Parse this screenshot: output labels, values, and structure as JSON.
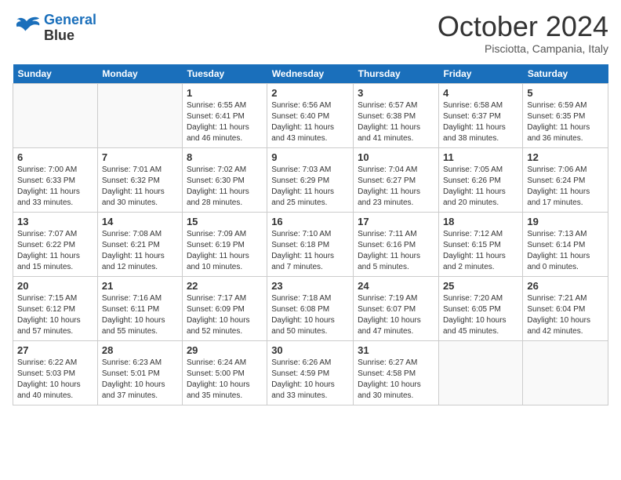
{
  "header": {
    "logo_line1": "General",
    "logo_line2": "Blue",
    "month_title": "October 2024",
    "location": "Pisciotta, Campania, Italy"
  },
  "days_of_week": [
    "Sunday",
    "Monday",
    "Tuesday",
    "Wednesday",
    "Thursday",
    "Friday",
    "Saturday"
  ],
  "weeks": [
    [
      {
        "day": "",
        "info": ""
      },
      {
        "day": "",
        "info": ""
      },
      {
        "day": "1",
        "info": "Sunrise: 6:55 AM\nSunset: 6:41 PM\nDaylight: 11 hours and 46 minutes."
      },
      {
        "day": "2",
        "info": "Sunrise: 6:56 AM\nSunset: 6:40 PM\nDaylight: 11 hours and 43 minutes."
      },
      {
        "day": "3",
        "info": "Sunrise: 6:57 AM\nSunset: 6:38 PM\nDaylight: 11 hours and 41 minutes."
      },
      {
        "day": "4",
        "info": "Sunrise: 6:58 AM\nSunset: 6:37 PM\nDaylight: 11 hours and 38 minutes."
      },
      {
        "day": "5",
        "info": "Sunrise: 6:59 AM\nSunset: 6:35 PM\nDaylight: 11 hours and 36 minutes."
      }
    ],
    [
      {
        "day": "6",
        "info": "Sunrise: 7:00 AM\nSunset: 6:33 PM\nDaylight: 11 hours and 33 minutes."
      },
      {
        "day": "7",
        "info": "Sunrise: 7:01 AM\nSunset: 6:32 PM\nDaylight: 11 hours and 30 minutes."
      },
      {
        "day": "8",
        "info": "Sunrise: 7:02 AM\nSunset: 6:30 PM\nDaylight: 11 hours and 28 minutes."
      },
      {
        "day": "9",
        "info": "Sunrise: 7:03 AM\nSunset: 6:29 PM\nDaylight: 11 hours and 25 minutes."
      },
      {
        "day": "10",
        "info": "Sunrise: 7:04 AM\nSunset: 6:27 PM\nDaylight: 11 hours and 23 minutes."
      },
      {
        "day": "11",
        "info": "Sunrise: 7:05 AM\nSunset: 6:26 PM\nDaylight: 11 hours and 20 minutes."
      },
      {
        "day": "12",
        "info": "Sunrise: 7:06 AM\nSunset: 6:24 PM\nDaylight: 11 hours and 17 minutes."
      }
    ],
    [
      {
        "day": "13",
        "info": "Sunrise: 7:07 AM\nSunset: 6:22 PM\nDaylight: 11 hours and 15 minutes."
      },
      {
        "day": "14",
        "info": "Sunrise: 7:08 AM\nSunset: 6:21 PM\nDaylight: 11 hours and 12 minutes."
      },
      {
        "day": "15",
        "info": "Sunrise: 7:09 AM\nSunset: 6:19 PM\nDaylight: 11 hours and 10 minutes."
      },
      {
        "day": "16",
        "info": "Sunrise: 7:10 AM\nSunset: 6:18 PM\nDaylight: 11 hours and 7 minutes."
      },
      {
        "day": "17",
        "info": "Sunrise: 7:11 AM\nSunset: 6:16 PM\nDaylight: 11 hours and 5 minutes."
      },
      {
        "day": "18",
        "info": "Sunrise: 7:12 AM\nSunset: 6:15 PM\nDaylight: 11 hours and 2 minutes."
      },
      {
        "day": "19",
        "info": "Sunrise: 7:13 AM\nSunset: 6:14 PM\nDaylight: 11 hours and 0 minutes."
      }
    ],
    [
      {
        "day": "20",
        "info": "Sunrise: 7:15 AM\nSunset: 6:12 PM\nDaylight: 10 hours and 57 minutes."
      },
      {
        "day": "21",
        "info": "Sunrise: 7:16 AM\nSunset: 6:11 PM\nDaylight: 10 hours and 55 minutes."
      },
      {
        "day": "22",
        "info": "Sunrise: 7:17 AM\nSunset: 6:09 PM\nDaylight: 10 hours and 52 minutes."
      },
      {
        "day": "23",
        "info": "Sunrise: 7:18 AM\nSunset: 6:08 PM\nDaylight: 10 hours and 50 minutes."
      },
      {
        "day": "24",
        "info": "Sunrise: 7:19 AM\nSunset: 6:07 PM\nDaylight: 10 hours and 47 minutes."
      },
      {
        "day": "25",
        "info": "Sunrise: 7:20 AM\nSunset: 6:05 PM\nDaylight: 10 hours and 45 minutes."
      },
      {
        "day": "26",
        "info": "Sunrise: 7:21 AM\nSunset: 6:04 PM\nDaylight: 10 hours and 42 minutes."
      }
    ],
    [
      {
        "day": "27",
        "info": "Sunrise: 6:22 AM\nSunset: 5:03 PM\nDaylight: 10 hours and 40 minutes."
      },
      {
        "day": "28",
        "info": "Sunrise: 6:23 AM\nSunset: 5:01 PM\nDaylight: 10 hours and 37 minutes."
      },
      {
        "day": "29",
        "info": "Sunrise: 6:24 AM\nSunset: 5:00 PM\nDaylight: 10 hours and 35 minutes."
      },
      {
        "day": "30",
        "info": "Sunrise: 6:26 AM\nSunset: 4:59 PM\nDaylight: 10 hours and 33 minutes."
      },
      {
        "day": "31",
        "info": "Sunrise: 6:27 AM\nSunset: 4:58 PM\nDaylight: 10 hours and 30 minutes."
      },
      {
        "day": "",
        "info": ""
      },
      {
        "day": "",
        "info": ""
      }
    ]
  ]
}
